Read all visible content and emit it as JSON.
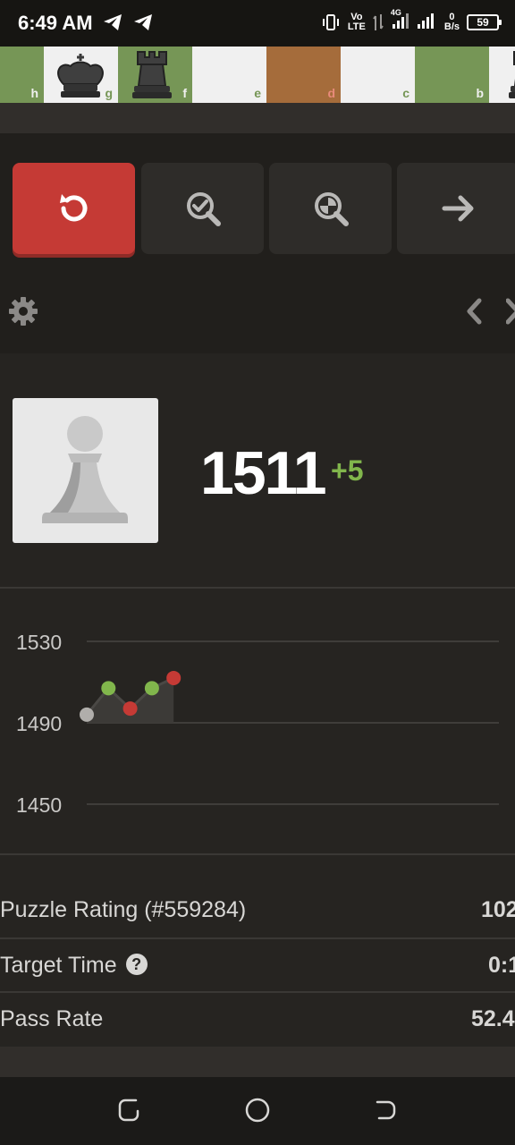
{
  "status_bar": {
    "time": "6:49 AM",
    "vo": "Vo",
    "lte": "LTE",
    "network": "4G",
    "speed_value": "0",
    "speed_unit": "B/s",
    "battery": "59",
    "icons": [
      "telegram-icon",
      "telegram-icon",
      "vibrate-icon",
      "signal-icon",
      "battery-icon"
    ]
  },
  "board": {
    "files": [
      "h",
      "g",
      "f",
      "e",
      "d",
      "c",
      "b"
    ],
    "pieces": [
      "black-king",
      "black-rook",
      "black-rook"
    ]
  },
  "controls": {
    "buttons": [
      "retry-icon",
      "hint-icon",
      "analysis-icon",
      "next-icon"
    ]
  },
  "rating": {
    "value": "1511",
    "change": "+5"
  },
  "chart_data": {
    "type": "line",
    "y_ticks": [
      "1530",
      "1490",
      "1450"
    ],
    "ylim": [
      1450,
      1530
    ],
    "points": [
      {
        "x": 0,
        "y": 1494,
        "result": "start"
      },
      {
        "x": 1,
        "y": 1507,
        "result": "pass"
      },
      {
        "x": 2,
        "y": 1497,
        "result": "fail"
      },
      {
        "x": 3,
        "y": 1507,
        "result": "pass"
      },
      {
        "x": 4,
        "y": 1512,
        "result": "fail"
      }
    ],
    "colors": {
      "pass": "#81b64c",
      "fail": "#c53a35",
      "start": "#b0aeab"
    }
  },
  "stats": [
    {
      "label": "Puzzle Rating (#559284)",
      "value": "102",
      "help": false
    },
    {
      "label": "Target Time",
      "value": "0:1",
      "help": true,
      "help_glyph": "?"
    },
    {
      "label": "Pass Rate",
      "value": "52.4",
      "help": false
    }
  ],
  "colors": {
    "background": "#262421",
    "accent_red": "#c53a35",
    "accent_green": "#81b64c"
  }
}
